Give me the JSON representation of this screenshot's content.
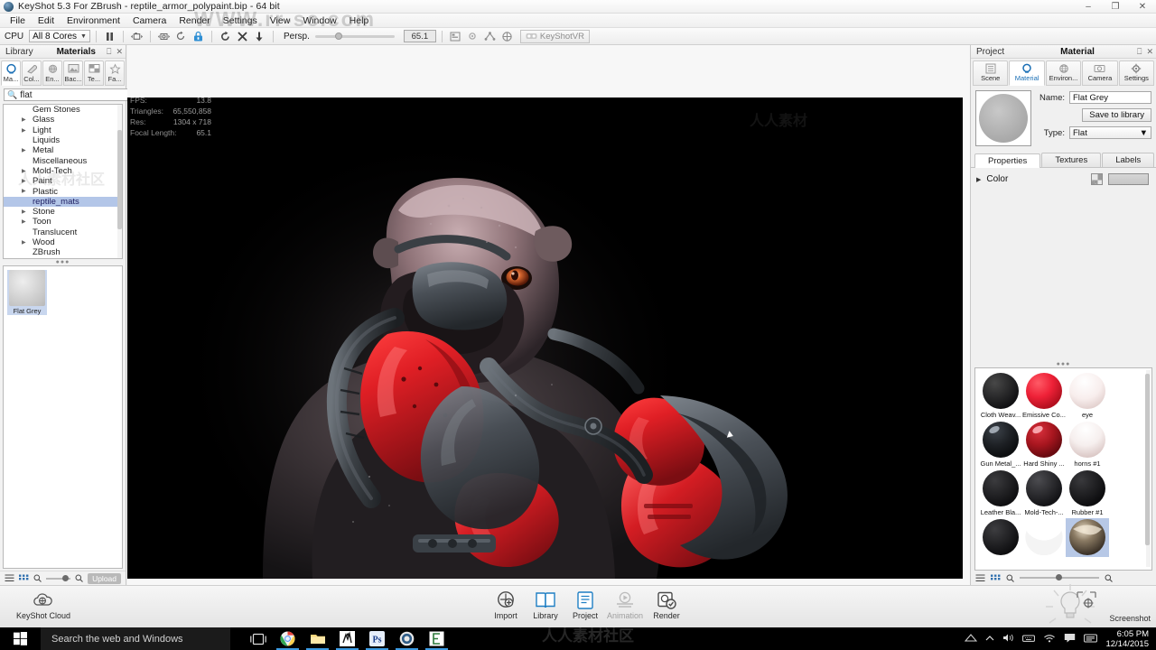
{
  "titlebar": {
    "title": "KeyShot 5.3 For ZBrush - reptile_armor_polypaint.bip  - 64 bit",
    "minimize": "–",
    "maximize": "❐",
    "close": "✕"
  },
  "menubar": {
    "items": [
      "File",
      "Edit",
      "Environment",
      "Camera",
      "Render",
      "Settings",
      "View",
      "Window",
      "Help"
    ]
  },
  "toolbar": {
    "cpu_label": "CPU",
    "cpu_value": "All 8 Cores",
    "persp_label": "Persp.",
    "focal_value": "65.1",
    "vr_label": "KeyShotVR",
    "icons": [
      "pause-icon",
      "camera-move-icon",
      "camera-frame-icon",
      "refresh-icon",
      "lock-icon",
      "rotate-icon",
      "scale-icon",
      "down-arrow-icon"
    ],
    "right_icons": [
      "panel-icon",
      "gear-icon",
      "network-icon",
      "region-icon"
    ]
  },
  "library_panel": {
    "tabs_top": [
      {
        "label": "Library",
        "active": false
      },
      {
        "label": "Materials",
        "active": true
      }
    ],
    "header_icons": [
      "undock-icon",
      "close-icon"
    ],
    "category_tabs": [
      {
        "label": "Ma...",
        "icon": "material-ball-icon",
        "active": true
      },
      {
        "label": "Col...",
        "icon": "color-icon",
        "active": false
      },
      {
        "label": "En...",
        "icon": "environment-icon",
        "active": false
      },
      {
        "label": "Bac...",
        "icon": "backplate-icon",
        "active": false
      },
      {
        "label": "Te...",
        "icon": "texture-icon",
        "active": false
      },
      {
        "label": "Fa...",
        "icon": "favorites-star-icon",
        "active": false
      }
    ],
    "search": {
      "value": "flat",
      "placeholder": "Search",
      "clear_icon": "clear-circle-icon",
      "icons": [
        "collapse-all-icon",
        "expand-all-icon"
      ]
    },
    "tree": [
      {
        "label": "Gem Stones",
        "expandable": false,
        "selected": false
      },
      {
        "label": "Glass",
        "expandable": true,
        "selected": false
      },
      {
        "label": "Light",
        "expandable": true,
        "selected": false
      },
      {
        "label": "Liquids",
        "expandable": false,
        "selected": false
      },
      {
        "label": "Metal",
        "expandable": true,
        "selected": false
      },
      {
        "label": "Miscellaneous",
        "expandable": false,
        "selected": false
      },
      {
        "label": "Mold-Tech",
        "expandable": true,
        "selected": false
      },
      {
        "label": "Paint",
        "expandable": true,
        "selected": false
      },
      {
        "label": "Plastic",
        "expandable": true,
        "selected": false
      },
      {
        "label": "reptile_mats",
        "expandable": false,
        "selected": true
      },
      {
        "label": "Stone",
        "expandable": true,
        "selected": false
      },
      {
        "label": "Toon",
        "expandable": true,
        "selected": false
      },
      {
        "label": "Translucent",
        "expandable": false,
        "selected": false
      },
      {
        "label": "Wood",
        "expandable": true,
        "selected": false
      },
      {
        "label": "ZBrush",
        "expandable": false,
        "selected": false
      }
    ],
    "results": [
      {
        "label": "Flat Grey",
        "selected": true
      }
    ],
    "footer": {
      "list_icon": "list-view-icon",
      "grid_icon": "grid-view-icon",
      "zoom_out_icon": "zoom-out-icon",
      "zoom_in_icon": "zoom-in-icon",
      "upload_label": "Upload"
    }
  },
  "viewport": {
    "hud": [
      {
        "key": "FPS:",
        "value": "13.8"
      },
      {
        "key": "Triangles:",
        "value": "65,550,858"
      },
      {
        "key": "Res:",
        "value": "1304 x 718"
      },
      {
        "key": "Focal Length:",
        "value": "65.1"
      }
    ]
  },
  "project_panel": {
    "tabs_top": [
      {
        "label": "Project",
        "active": false
      },
      {
        "label": "Material",
        "active": true
      }
    ],
    "header_icons": [
      "undock-icon",
      "close-icon"
    ],
    "tabs": [
      {
        "label": "Scene",
        "icon": "scene-tree-icon",
        "active": false
      },
      {
        "label": "Material",
        "icon": "material-ball-icon",
        "active": true
      },
      {
        "label": "Environ...",
        "icon": "globe-icon",
        "active": false
      },
      {
        "label": "Camera",
        "icon": "camera-icon",
        "active": false
      },
      {
        "label": "Settings",
        "icon": "gear-icon",
        "active": false
      }
    ],
    "name_label": "Name:",
    "name_value": "Flat Grey",
    "save_to_library": "Save to library",
    "type_label": "Type:",
    "type_value": "Flat",
    "subtabs": [
      {
        "label": "Properties",
        "active": true
      },
      {
        "label": "Textures",
        "active": false
      },
      {
        "label": "Labels",
        "active": false
      }
    ],
    "properties": {
      "color_label": "Color",
      "color_swatch": "#cfcfcf",
      "texture_icon": "checker-icon"
    },
    "library_items": [
      {
        "label": "Cloth Weav...",
        "color": "#1d1d1f",
        "highlight": "#484848",
        "selected": false
      },
      {
        "label": "Emissive Co...",
        "color": "#ee2137",
        "highlight": "#ff6070",
        "selected": false
      },
      {
        "label": "eye",
        "color": "#f6eceb",
        "highlight": "#ffffff",
        "selected": false
      },
      {
        "label": "Gun Metal_...",
        "color": "#222226",
        "highlight": "#8d95a0",
        "selected": false
      },
      {
        "label": "Hard Shiny ...",
        "color": "#b51a25",
        "highlight": "#ff8f96",
        "selected": false
      },
      {
        "label": "horns #1",
        "color": "#f2e9e8",
        "highlight": "#ffffff",
        "selected": false
      },
      {
        "label": "Leather Bla...",
        "color": "#1c1c1e",
        "highlight": "#3c3c3e",
        "selected": false
      },
      {
        "label": "Mold-Tech-...",
        "color": "#2a2a2e",
        "highlight": "#4e4e52",
        "selected": false
      },
      {
        "label": "Rubber #1",
        "color": "#1a1a1c",
        "highlight": "#3a3a3c",
        "selected": false
      },
      {
        "label": "",
        "color": "#1b1b1d",
        "highlight": "#3d3d3f",
        "selected": false
      },
      {
        "label": "",
        "color": "#f4f4f4",
        "highlight": "#ffffff",
        "selected": false
      },
      {
        "label": "",
        "color": "#4a4036",
        "highlight": "#d8cdbb",
        "selected": true
      }
    ],
    "footer": {
      "list_icon": "list-view-icon",
      "grid_icon": "grid-view-icon",
      "zoom_out_icon": "zoom-out-icon",
      "zoom_in_icon": "zoom-in-icon"
    }
  },
  "bottom_bar": {
    "cloud_label": "KeyShot Cloud",
    "items": [
      {
        "label": "Import",
        "icon": "import-icon",
        "dim": false
      },
      {
        "label": "Library",
        "icon": "library-book-icon",
        "dim": false
      },
      {
        "label": "Project",
        "icon": "project-icon",
        "dim": false
      },
      {
        "label": "Animation",
        "icon": "animation-icon",
        "dim": true
      },
      {
        "label": "Render",
        "icon": "render-icon",
        "dim": false
      }
    ],
    "screenshot_label": "Screenshot"
  },
  "taskbar": {
    "search_placeholder": "Search the web and Windows",
    "start_icon": "windows-start-icon",
    "apps": [
      {
        "name": "task-view-icon",
        "active": false
      },
      {
        "name": "chrome-icon",
        "active": true
      },
      {
        "name": "file-explorer-icon",
        "active": true
      },
      {
        "name": "zbrush-icon",
        "active": true
      },
      {
        "name": "photoshop-icon",
        "active": true
      },
      {
        "name": "keyshot-icon",
        "active": true
      },
      {
        "name": "camtasia-icon",
        "active": true
      }
    ],
    "tray_icons": [
      "nvidia-icon",
      "chevron-up-icon",
      "volume-icon",
      "keyboard-icon",
      "wifi-icon",
      "action-center-icon",
      "ime-icon"
    ],
    "time": "6:05 PM",
    "date": "12/14/2015"
  },
  "watermarks": [
    "WWW.rr-sc.com",
    "人人素材社区",
    "人人素材",
    "人人素材社区"
  ]
}
